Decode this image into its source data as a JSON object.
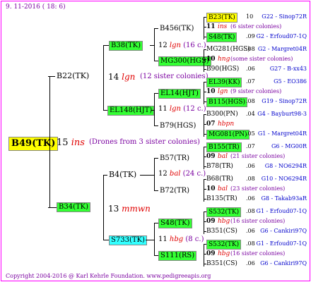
{
  "date": "9. 11-2016 ( 18:  6)",
  "copyright": "Copyright 2004-2016 @ Karl Kehrle Foundation.   www.pedigreeapis.org",
  "root": {
    "id": "B49(TK)",
    "num": "15",
    "mark": "ins",
    "note": "(Drones from 3 sister colonies)"
  },
  "gen1": {
    "b22": "B22(TK)",
    "b22_num": "14",
    "b22_mark": "lgn",
    "b22_note": "(12 sister colonies)",
    "b34": "B34(TK)",
    "b34_num": "13",
    "b34_mark": "mmwn"
  },
  "gen2": {
    "b38": "B38(TK)",
    "b38_note": "(16 c.)",
    "el148": "EL148(HJT)",
    "el148_num": "11",
    "el148_mark": "lgn",
    "el148_note": "(12 c.)",
    "b4": "B4(TK)",
    "b4_num": "12",
    "b4_mark": "bal",
    "b4_note": "(24 c.)",
    "s733": "S733(TK)",
    "s733_num": "11",
    "s733_mark": "hbg",
    "s733_note": "(8 c.)"
  },
  "gen3": {
    "b456": "B456(TK)",
    "b456_mid": "12",
    "b456_mark": "lgn",
    "mg300": "MG300(HGS)",
    "el14": "EL14(HJT)",
    "b79": "B79(HGS)",
    "b57": "B57(TR)",
    "b72": "B72(TR)",
    "s48": "S48(TK)",
    "s48_num": "09",
    "s48_mark": "hbg",
    "s48_note": "(16 c.)",
    "s111": "S111(RS)"
  },
  "rows": [
    {
      "id": "B23(TK)",
      "y": "10",
      "note": "",
      "mark": "",
      "ref": "G22 - Sinop72R"
    },
    {
      "id": "11",
      "y": "",
      "note": "(6 sister colonies)",
      "mark": "ins",
      "ref": ""
    },
    {
      "id": "S48(TK)",
      "y": ".09",
      "note": "",
      "mark": "",
      "ref": "G2 - Erfoud07-1Q"
    },
    {
      "id": "MG281(HGS)",
      "y": ".08",
      "note": "",
      "mark": "",
      "ref": "G2 - Margret04R"
    },
    {
      "id": "10",
      "y": "",
      "note": "(some sister colonies)",
      "mark": "hng",
      "ref": ""
    },
    {
      "id": "B90(HGS)",
      "y": ".06",
      "note": "",
      "mark": "",
      "ref": "G27 - B-xx43"
    },
    {
      "id": "EL39(KK)",
      "y": ".07",
      "note": "",
      "mark": "",
      "ref": "G5 - EO386"
    },
    {
      "id": "10",
      "y": "",
      "note": "(9 sister colonies)",
      "mark": "lgn",
      "ref": ""
    },
    {
      "id": "B115(HGS)",
      "y": ".08",
      "note": "",
      "mark": "",
      "ref": "G19 - Sinop72R"
    },
    {
      "id": "B300(PN)",
      "y": ".04",
      "note": "",
      "mark": "",
      "ref": "G4 - Bayburt98-3"
    },
    {
      "id": "07",
      "y": "",
      "note": "",
      "mark": "hbpn",
      "ref": ""
    },
    {
      "id": "MG081(PN)",
      "y": ".05",
      "note": "",
      "mark": "",
      "ref": "G1 - Margret04R"
    },
    {
      "id": "B155(TR)",
      "y": ".07",
      "note": "",
      "mark": "",
      "ref": "G6 - MG00R"
    },
    {
      "id": "09",
      "y": "",
      "note": "(21 sister colonies)",
      "mark": "bal",
      "ref": ""
    },
    {
      "id": "B78(TR)",
      "y": ".06",
      "note": "",
      "mark": "",
      "ref": "G8 - NO6294R"
    },
    {
      "id": "B68(TR)",
      "y": ".08",
      "note": "",
      "mark": "",
      "ref": "G10 - NO6294R"
    },
    {
      "id": "10",
      "y": "",
      "note": "(23 sister colonies)",
      "mark": "bal",
      "ref": ""
    },
    {
      "id": "B135(TR)",
      "y": ".06",
      "note": "",
      "mark": "",
      "ref": "G8 - Takab93aR"
    },
    {
      "id": "S532(TK)",
      "y": ".08",
      "note": "",
      "mark": "",
      "ref": "G1 - Erfoud07-1Q"
    },
    {
      "id": "09",
      "y": "",
      "note": "(16 sister colonies)",
      "mark": "hbg",
      "ref": ""
    },
    {
      "id": "B351(CS)",
      "y": ".06",
      "note": "",
      "mark": "",
      "ref": "G6 - Cankiri97Q"
    },
    {
      "id": "S532(TK)",
      "y": ".08",
      "note": "",
      "mark": "",
      "ref": "G1 - Erfoud07-1Q"
    },
    {
      "id": "09",
      "y": "",
      "note": "(16 sister colonies)",
      "mark": "hbg",
      "ref": ""
    },
    {
      "id": "B351(CS)",
      "y": ".06",
      "note": "",
      "mark": "",
      "ref": "G6 - Cankiri97Q"
    }
  ]
}
